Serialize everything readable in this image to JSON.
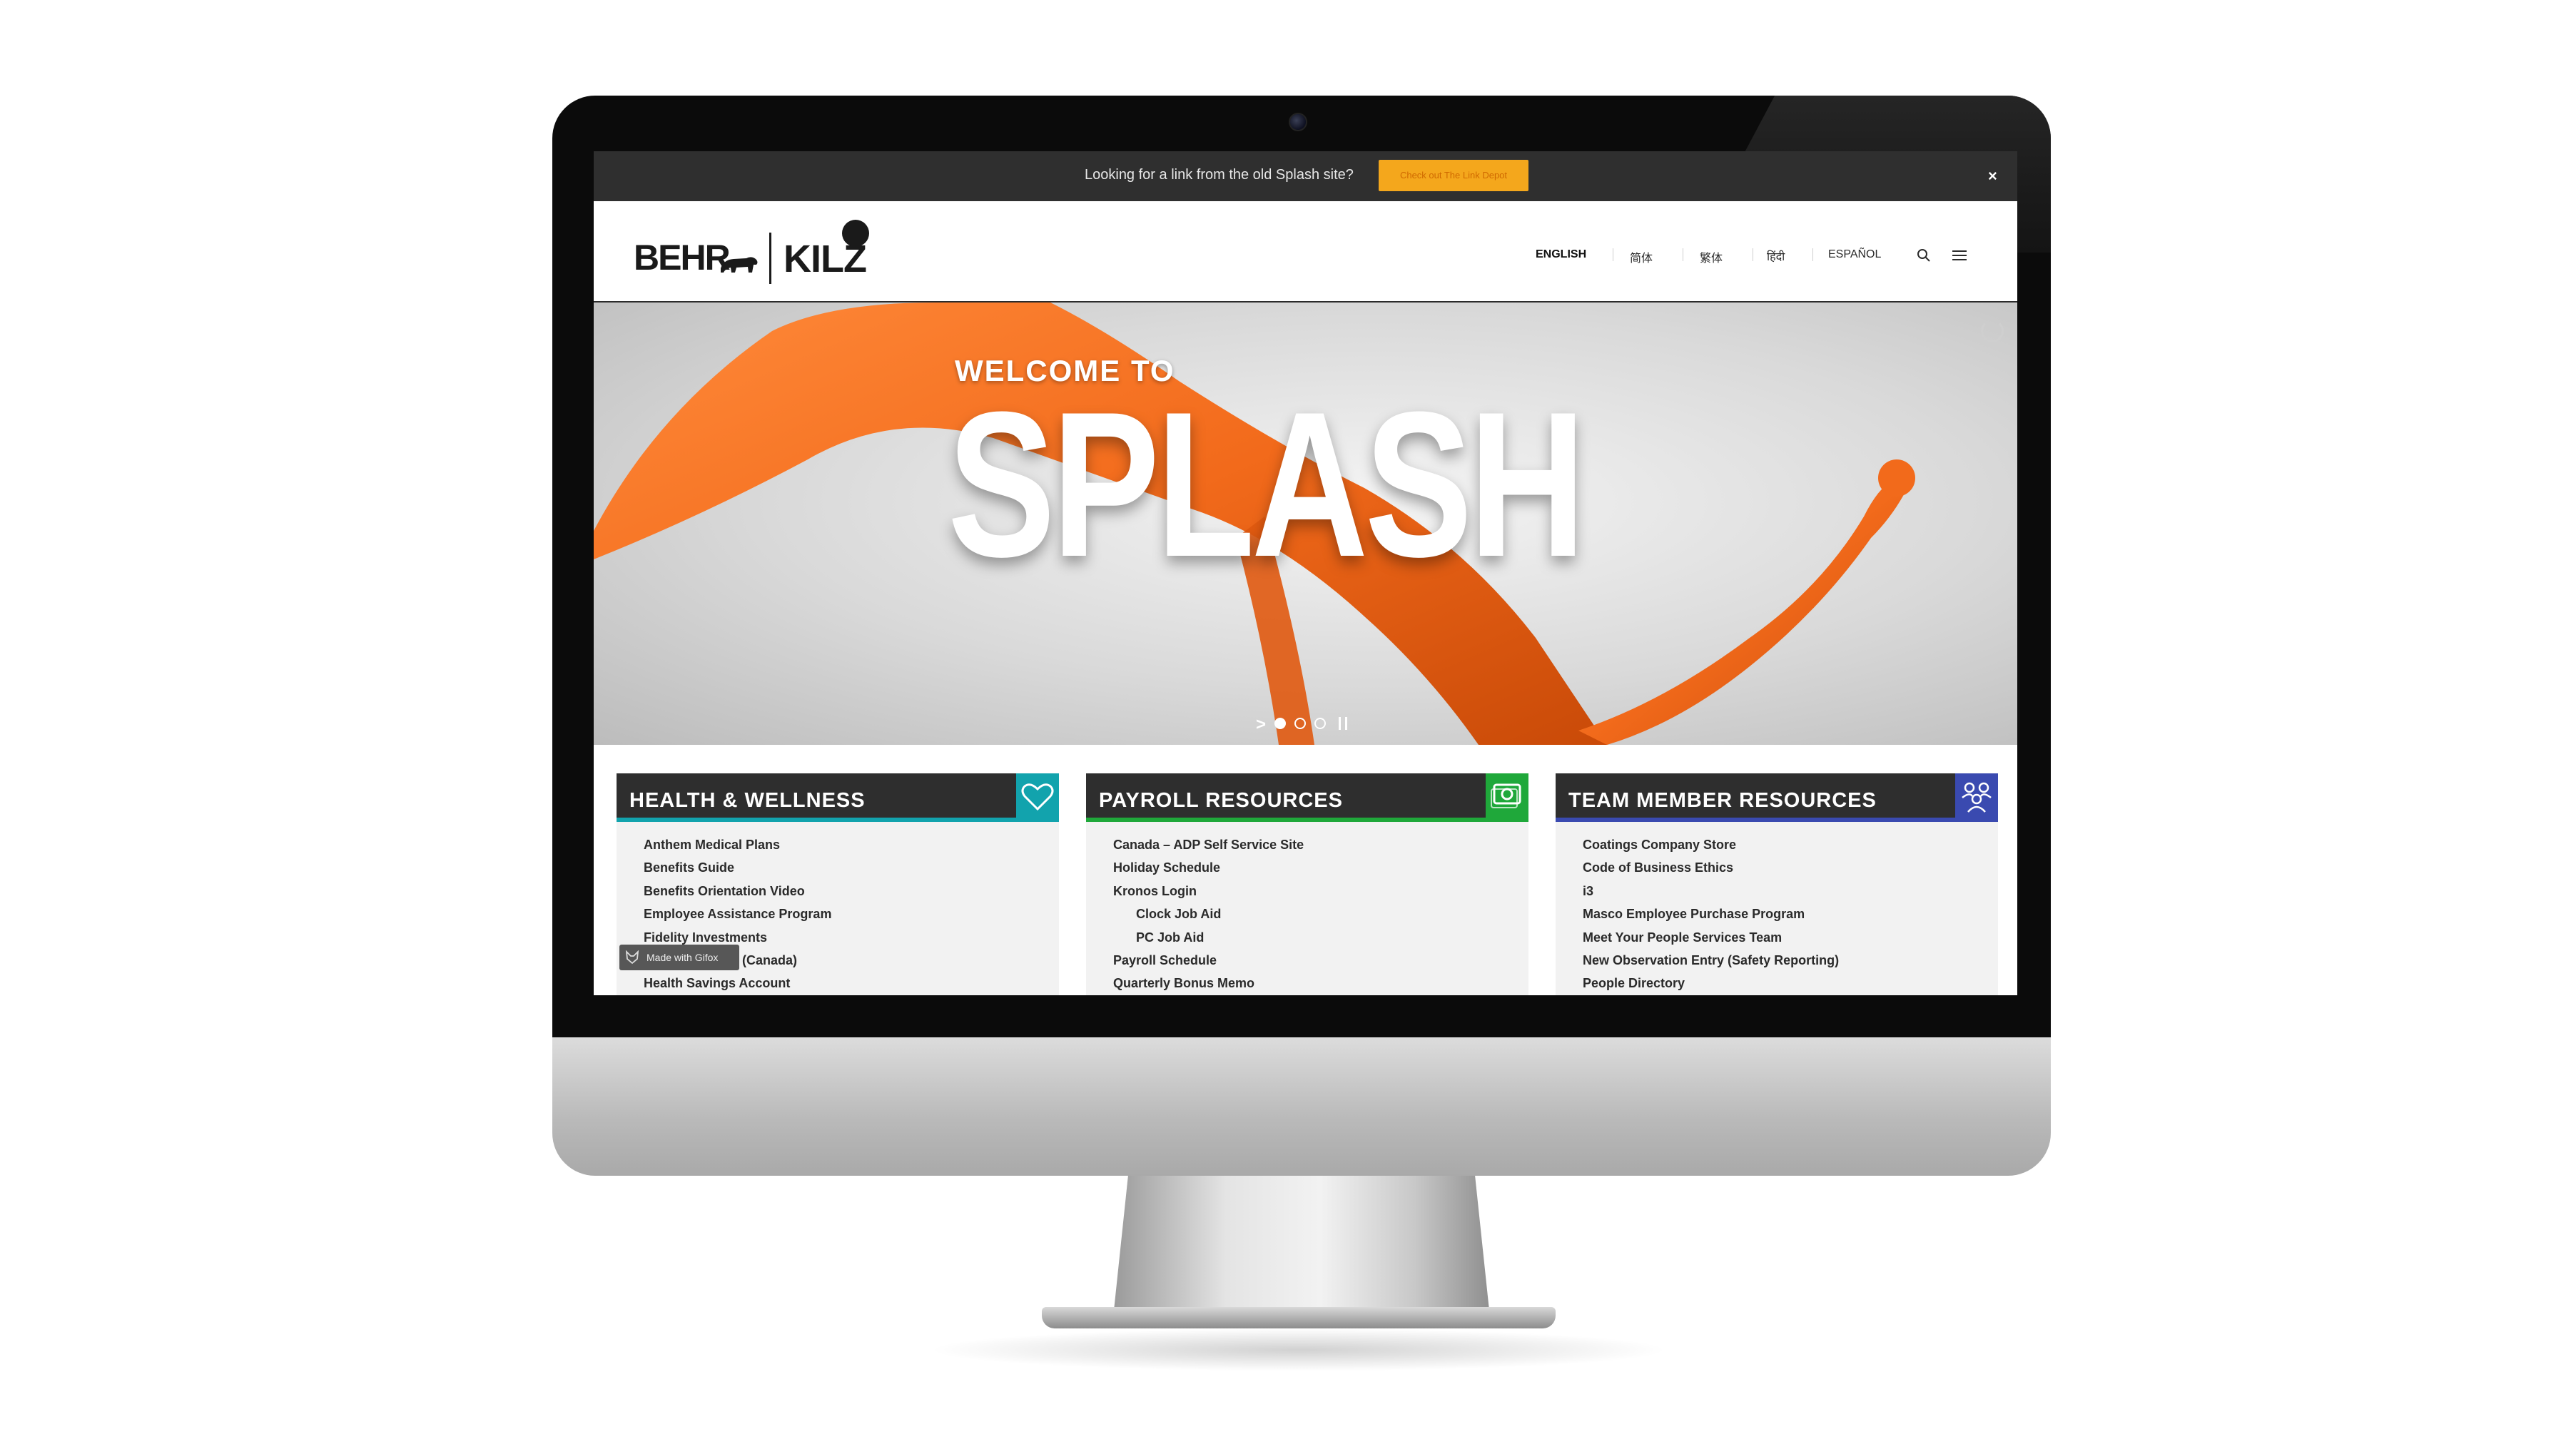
{
  "notice": {
    "text": "Looking for a link from the old Splash site?",
    "button_label": "Check out The Link Depot",
    "close_label": "×"
  },
  "header": {
    "logo_behr": "BEHR",
    "logo_kilz": "KILZ",
    "languages": [
      "ENGLISH",
      "简体",
      "繁体",
      "हिंदी",
      "ESPAÑOL"
    ],
    "active_language": "ENGLISH"
  },
  "hero": {
    "kicker": "WELCOME TO",
    "title": "SPLASH",
    "carousel_arrow": ">",
    "slide_count": 3,
    "active_slide": 1
  },
  "cards": [
    {
      "title": "HEALTH & WELLNESS",
      "accent": "#12a3ad",
      "icon": "heart-icon",
      "items": [
        "Anthem Medical Plans",
        "Benefits Guide",
        "Benefits Orientation Video",
        "Employee Assistance Program",
        "Fidelity Investments",
        "(Canada)",
        "Health Savings Account"
      ]
    },
    {
      "title": "PAYROLL RESOURCES",
      "accent": "#1fa83a",
      "icon": "money-icon",
      "items": [
        "Canada – ADP Self Service Site",
        "Holiday Schedule",
        "Kronos Login",
        "Clock Job Aid",
        "PC Job Aid",
        "Payroll Schedule",
        "Quarterly Bonus Memo"
      ],
      "sub_items": [
        3,
        4
      ]
    },
    {
      "title": "TEAM MEMBER RESOURCES",
      "accent": "#3a4ab0",
      "icon": "team-icon",
      "items": [
        "Coatings Company Store",
        "Code of Business Ethics",
        "i3",
        "Masco Employee Purchase Program",
        "Meet Your People Services Team",
        "New Observation Entry (Safety Reporting)",
        "People Directory"
      ]
    }
  ],
  "gifox": {
    "label": "Made with Gifox"
  },
  "colors": {
    "notice_bg": "#2f2f2f",
    "notice_button": "#f4a71c",
    "splash_orange": "#f26a1b"
  }
}
